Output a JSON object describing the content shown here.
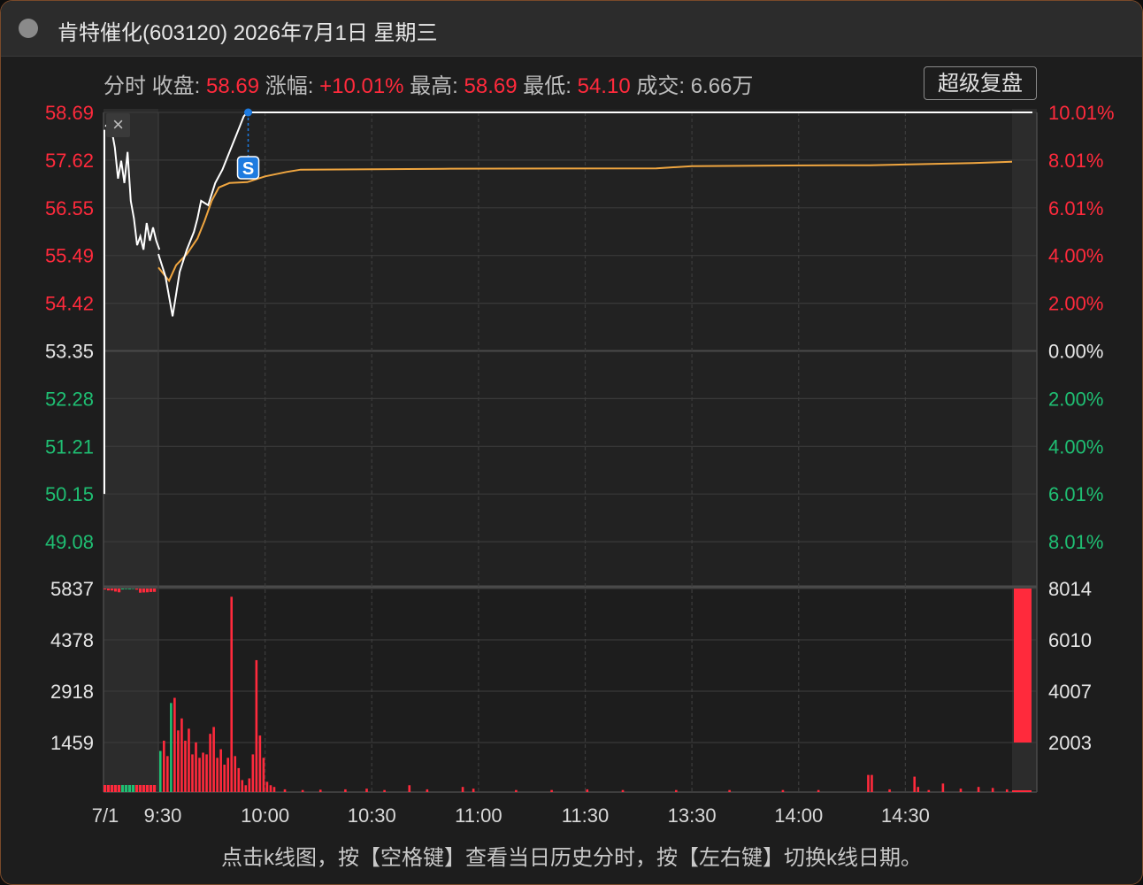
{
  "window": {
    "title": "肯特催化(603120) 2026年7月1日 星期三"
  },
  "info": {
    "mode": "分时",
    "close_label": "收盘:",
    "close_value": "58.69",
    "change_label": "涨幅:",
    "change_value": "+10.01%",
    "high_label": "最高:",
    "high_value": "58.69",
    "low_label": "最低:",
    "low_value": "54.10",
    "volume_label": "成交:",
    "volume_value": "6.66万",
    "super_review_button": "超级复盘"
  },
  "footer": {
    "hint": "点击k线图，按【空格键】查看当日历史分时，按【左右键】切换k线日期。"
  },
  "colors": {
    "up": "#ff2a3c",
    "down": "#1fbf73",
    "flat": "#e6e6e6",
    "avg_line": "#f0a640",
    "price_line": "#ffffff",
    "marker": "#1e7be0"
  },
  "chart_data": {
    "type": "line",
    "price_axis_left": [
      "58.69",
      "57.62",
      "56.55",
      "55.49",
      "54.42",
      "53.35",
      "52.28",
      "51.21",
      "50.15",
      "49.08"
    ],
    "price_axis_right": [
      "10.01%",
      "8.01%",
      "6.01%",
      "4.00%",
      "2.00%",
      "0.00%",
      "2.00%",
      "4.00%",
      "6.01%",
      "8.01%"
    ],
    "volume_axis_left": [
      "5837",
      "4378",
      "2918",
      "1459"
    ],
    "volume_axis_right": [
      "8014",
      "6010",
      "4007",
      "2003"
    ],
    "x_ticks": [
      "7/1",
      "9:30",
      "10:00",
      "10:30",
      "11:00",
      "11:30",
      "13:30",
      "14:00",
      "14:30"
    ],
    "prev_close": 53.35,
    "price_range": [
      48.01,
      58.69
    ],
    "volume_max": 5837,
    "premarket_price": [
      [
        0,
        58.4
      ],
      [
        2,
        58.3
      ],
      [
        3,
        57.9
      ],
      [
        4,
        57.2
      ],
      [
        5,
        57.6
      ],
      [
        6,
        57.1
      ],
      [
        7,
        57.8
      ],
      [
        8,
        56.7
      ],
      [
        9,
        56.3
      ],
      [
        10,
        55.7
      ],
      [
        11,
        55.9
      ],
      [
        12,
        55.6
      ],
      [
        13,
        56.2
      ],
      [
        14,
        55.8
      ],
      [
        15,
        56.1
      ],
      [
        16,
        55.8
      ],
      [
        17,
        55.6
      ]
    ],
    "price_series": [
      [
        0,
        55.5
      ],
      [
        2,
        55.0
      ],
      [
        4,
        54.1
      ],
      [
        5,
        54.6
      ],
      [
        6,
        55.1
      ],
      [
        8,
        55.6
      ],
      [
        10,
        56.0
      ],
      [
        11,
        56.3
      ],
      [
        12,
        56.7
      ],
      [
        14,
        56.6
      ],
      [
        16,
        57.1
      ],
      [
        18,
        57.4
      ],
      [
        20,
        57.8
      ],
      [
        22,
        58.2
      ],
      [
        24,
        58.6
      ],
      [
        25,
        58.69
      ],
      [
        240,
        58.69
      ]
    ],
    "avg_series": [
      [
        0,
        55.2
      ],
      [
        3,
        54.9
      ],
      [
        5,
        55.25
      ],
      [
        8,
        55.5
      ],
      [
        11,
        55.85
      ],
      [
        13,
        56.25
      ],
      [
        15,
        56.7
      ],
      [
        17,
        57.0
      ],
      [
        20,
        57.1
      ],
      [
        25,
        57.12
      ],
      [
        30,
        57.25
      ],
      [
        36,
        57.35
      ],
      [
        40,
        57.4
      ],
      [
        80,
        57.42
      ],
      [
        140,
        57.43
      ],
      [
        150,
        57.48
      ],
      [
        190,
        57.5
      ],
      [
        200,
        57.5
      ],
      [
        229,
        57.55
      ],
      [
        240,
        57.58
      ]
    ],
    "marker": {
      "label": "S",
      "minute": 25
    },
    "volume": [
      {
        "m": 0,
        "v": 1200,
        "c": "down"
      },
      {
        "m": 1,
        "v": 1500,
        "c": "up"
      },
      {
        "m": 2,
        "v": 1050,
        "c": "up"
      },
      {
        "m": 3,
        "v": 2600,
        "c": "down"
      },
      {
        "m": 4,
        "v": 2750,
        "c": "up"
      },
      {
        "m": 5,
        "v": 1800,
        "c": "up"
      },
      {
        "m": 6,
        "v": 2150,
        "c": "up"
      },
      {
        "m": 7,
        "v": 1500,
        "c": "up"
      },
      {
        "m": 8,
        "v": 1850,
        "c": "up"
      },
      {
        "m": 9,
        "v": 1100,
        "c": "up"
      },
      {
        "m": 10,
        "v": 1450,
        "c": "up"
      },
      {
        "m": 11,
        "v": 1000,
        "c": "up"
      },
      {
        "m": 12,
        "v": 1150,
        "c": "up"
      },
      {
        "m": 13,
        "v": 1100,
        "c": "up"
      },
      {
        "m": 14,
        "v": 1700,
        "c": "up"
      },
      {
        "m": 15,
        "v": 1900,
        "c": "up"
      },
      {
        "m": 16,
        "v": 1000,
        "c": "up"
      },
      {
        "m": 17,
        "v": 1250,
        "c": "up"
      },
      {
        "m": 18,
        "v": 800,
        "c": "up"
      },
      {
        "m": 19,
        "v": 1000,
        "c": "up"
      },
      {
        "m": 20,
        "v": 5700,
        "c": "up"
      },
      {
        "m": 21,
        "v": 1050,
        "c": "up"
      },
      {
        "m": 22,
        "v": 700,
        "c": "up"
      },
      {
        "m": 23,
        "v": 350,
        "c": "up"
      },
      {
        "m": 24,
        "v": 200,
        "c": "up"
      },
      {
        "m": 25,
        "v": 400,
        "c": "up"
      },
      {
        "m": 26,
        "v": 1100,
        "c": "up"
      },
      {
        "m": 27,
        "v": 3850,
        "c": "up"
      },
      {
        "m": 28,
        "v": 1650,
        "c": "up"
      },
      {
        "m": 29,
        "v": 1000,
        "c": "up"
      },
      {
        "m": 30,
        "v": 300,
        "c": "up"
      },
      {
        "m": 31,
        "v": 200,
        "c": "up"
      },
      {
        "m": 32,
        "v": 150,
        "c": "up"
      },
      {
        "m": 35,
        "v": 80,
        "c": "up"
      },
      {
        "m": 40,
        "v": 60,
        "c": "up"
      },
      {
        "m": 45,
        "v": 70,
        "c": "up"
      },
      {
        "m": 52,
        "v": 80,
        "c": "up"
      },
      {
        "m": 58,
        "v": 100,
        "c": "up"
      },
      {
        "m": 63,
        "v": 60,
        "c": "up"
      },
      {
        "m": 70,
        "v": 200,
        "c": "up"
      },
      {
        "m": 75,
        "v": 80,
        "c": "up"
      },
      {
        "m": 85,
        "v": 150,
        "c": "up"
      },
      {
        "m": 88,
        "v": 100,
        "c": "up"
      },
      {
        "m": 100,
        "v": 60,
        "c": "up"
      },
      {
        "m": 110,
        "v": 60,
        "c": "up"
      },
      {
        "m": 120,
        "v": 80,
        "c": "up"
      },
      {
        "m": 130,
        "v": 60,
        "c": "up"
      },
      {
        "m": 145,
        "v": 60,
        "c": "up"
      },
      {
        "m": 160,
        "v": 60,
        "c": "up"
      },
      {
        "m": 175,
        "v": 60,
        "c": "up"
      },
      {
        "m": 185,
        "v": 60,
        "c": "up"
      },
      {
        "m": 199,
        "v": 500,
        "c": "up"
      },
      {
        "m": 200,
        "v": 500,
        "c": "up"
      },
      {
        "m": 205,
        "v": 80,
        "c": "up"
      },
      {
        "m": 212,
        "v": 450,
        "c": "up"
      },
      {
        "m": 213,
        "v": 150,
        "c": "up"
      },
      {
        "m": 216,
        "v": 60,
        "c": "up"
      },
      {
        "m": 220,
        "v": 250,
        "c": "up"
      },
      {
        "m": 225,
        "v": 100,
        "c": "up"
      },
      {
        "m": 230,
        "v": 150,
        "c": "up"
      },
      {
        "m": 234,
        "v": 120,
        "c": "up"
      },
      {
        "m": 238,
        "v": 80,
        "c": "up"
      }
    ],
    "premarket_volume": [
      {
        "x": 0,
        "v": 120,
        "c": "up"
      },
      {
        "x": 1,
        "v": 250,
        "c": "up"
      },
      {
        "x": 2,
        "v": 260,
        "c": "up"
      },
      {
        "x": 3,
        "v": 400,
        "c": "up"
      },
      {
        "x": 4,
        "v": 500,
        "c": "up"
      },
      {
        "x": 5,
        "v": 120,
        "c": "down"
      },
      {
        "x": 6,
        "v": 80,
        "c": "down"
      },
      {
        "x": 7,
        "v": 100,
        "c": "down"
      },
      {
        "x": 8,
        "v": 60,
        "c": "down"
      },
      {
        "x": 9,
        "v": 150,
        "c": "up"
      },
      {
        "x": 10,
        "v": 550,
        "c": "up"
      },
      {
        "x": 11,
        "v": 520,
        "c": "up"
      },
      {
        "x": 12,
        "v": 500,
        "c": "up"
      },
      {
        "x": 13,
        "v": 460,
        "c": "up"
      },
      {
        "x": 14,
        "v": 440,
        "c": "up"
      }
    ],
    "postmarket_volume_top": 8014,
    "postmarket_volume_bottom": 1720
  }
}
